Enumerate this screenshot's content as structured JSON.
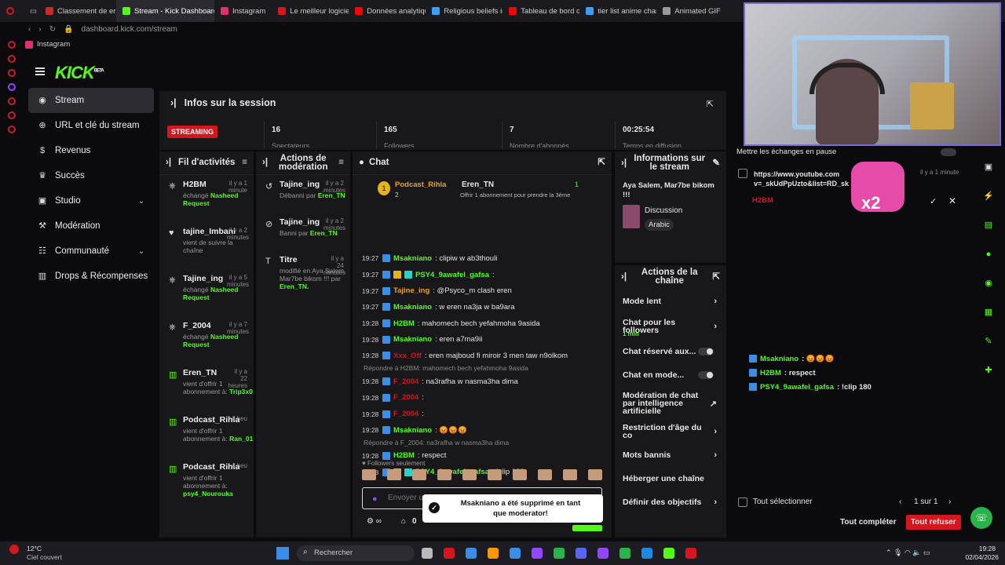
{
  "browser": {
    "tabs": [
      {
        "label": "Classement de ere",
        "color": "#cc2a2a"
      },
      {
        "label": "Stream - Kick Dashboard",
        "color": "#53fc18"
      },
      {
        "label": "Instagram",
        "color": "#e1306c"
      },
      {
        "label": "Le meilleur logicie",
        "color": "#d4171e"
      },
      {
        "label": "Données analytiqu",
        "color": "#ff0000"
      },
      {
        "label": "Religious beliefs in",
        "color": "#3aa0ff"
      },
      {
        "label": "Tableau de bord c",
        "color": "#ff0000"
      },
      {
        "label": "tier list anime char",
        "color": "#3aa0ff"
      },
      {
        "label": "Animated GIF",
        "color": "#9a9a9a"
      }
    ],
    "url": "dashboard.kick.com/stream",
    "bookmark": "Instagram"
  },
  "logo": "KICK",
  "logo_badge": "BETA",
  "nav": [
    {
      "label": "Stream",
      "icon": "broadcast-icon"
    },
    {
      "label": "URL et clé du stream",
      "icon": "link-icon"
    },
    {
      "label": "Revenus",
      "icon": "dollar-icon"
    },
    {
      "label": "Succès",
      "icon": "trophy-icon"
    },
    {
      "label": "Studio",
      "icon": "studio-icon",
      "chev": "⌄"
    },
    {
      "label": "Modération",
      "icon": "hammer-icon"
    },
    {
      "label": "Communauté",
      "icon": "community-icon",
      "chev": "⌄"
    },
    {
      "label": "Drops & Récompenses",
      "icon": "gift-icon"
    }
  ],
  "infos": {
    "title": "Infos sur la session",
    "badge": "STREAMING",
    "stats": [
      {
        "value": "16",
        "label": "Spectateurs"
      },
      {
        "value": "165",
        "label": "Followers"
      },
      {
        "value": "7",
        "label": "Nombre d'abonnés"
      },
      {
        "value": "00:25:54",
        "label": "Temps en diffusion"
      }
    ]
  },
  "activity": {
    "title": "Fil d'activités",
    "items": [
      {
        "name": "H2BM",
        "time": "il y a 1 minute",
        "line1": "échangé",
        "hl": "Nasheed Request",
        "icon": "steering-icon"
      },
      {
        "name": "tajine_Imbani",
        "time": "il y a 2 minutes",
        "line1": "vient de suivre la chaîne",
        "hl": "",
        "icon": "heart-icon"
      },
      {
        "name": "Tajine_ing",
        "time": "il y a 5 minutes",
        "line1": "échangé",
        "hl": "Nasheed Request",
        "icon": "steering-icon"
      },
      {
        "name": "F_2004",
        "time": "il y a 7 minutes",
        "line1": "échangé",
        "hl": "Nasheed Request",
        "icon": "steering-icon"
      },
      {
        "name": "Eren_TN",
        "time": "il y a 22 heures",
        "line1": "vient d'offrir 1 abonnement à:",
        "hl": "Trip3x0",
        "icon": "gift-icon"
      },
      {
        "name": "Podcast_Rihla",
        "time": "il heu",
        "line1": "vient d'offrir 1 abonnement à:",
        "hl": "Ran_01",
        "icon": "gift-icon"
      },
      {
        "name": "Podcast_Rihla",
        "time": "il heu",
        "line1": "vient d'offrir 1 abonnement à:",
        "hl": "psy4_Nourouka",
        "icon": "gift-icon"
      }
    ]
  },
  "modactions": {
    "title": "Actions de modération",
    "items": [
      {
        "name": "Tajine_ing",
        "time": "il y a 2 minutes",
        "line1": "Débanni par",
        "hl": "Eren_TN",
        "icon": "unban-icon"
      },
      {
        "name": "Tajine_ing",
        "time": "il y a 2 minutes",
        "line1": "Banni par",
        "hl": "Eren_TN",
        "icon": "ban-icon"
      },
      {
        "name": "Titre",
        "time": "il y a 24 minutes",
        "line1": "modifié en Aya Salem, Mar7be bikom !!! par",
        "hl": "Eren_TN.",
        "icon": "tag-icon"
      }
    ]
  },
  "chat": {
    "title": "Chat",
    "pinned_user": "Podcast_Rihla",
    "pinned_count": "2",
    "gifter": "Eren_TN",
    "gift_count": "1",
    "gift_text": "Offrir 1 abonnement pour prendre la 3ème",
    "messages": [
      {
        "time": "19:27",
        "user": "Msakniano",
        "color": "#53fc18",
        "text": ": clipiw w ab3thouli"
      },
      {
        "time": "19:27",
        "user": "PSY4_9awafel_gafsa",
        "color": "#53fc18",
        "text": ":"
      },
      {
        "time": "19:27",
        "user": "Tajine_ing",
        "color": "#e8a31f",
        "text": ": @Psyco_m clash eren"
      },
      {
        "time": "19:27",
        "user": "Msakniano",
        "color": "#53fc18",
        "text": ": w eren na3ja w ba9ara"
      },
      {
        "time": "19:28",
        "user": "H2BM",
        "color": "#53fc18",
        "text": ": mahomech bech yefahmoha 9asida"
      },
      {
        "time": "19:28",
        "user": "Msakniano",
        "color": "#53fc18",
        "text": ": eren a7ma9ii"
      },
      {
        "time": "19:28",
        "user": "Xxx_Off",
        "color": "#d4171e",
        "text": ": eren majboud fi miroir 3 men taw n9olkom"
      },
      {
        "reply": "Répondre à H2BM: mahomech bech yefahmoha 9asida"
      },
      {
        "time": "19:28",
        "user": "F_2004",
        "color": "#d4171e",
        "text": ": na3rafha w nasma3ha dima"
      },
      {
        "time": "19:28",
        "user": "F_2004",
        "color": "#d4171e",
        "text": ":"
      },
      {
        "time": "19:28",
        "user": "F_2004",
        "color": "#d4171e",
        "text": ":"
      },
      {
        "time": "19:28",
        "user": "Msakniano",
        "color": "#53fc18",
        "text": ": 😡😡😡"
      },
      {
        "reply": "Répondre à F_2004: na3rafha w nasma3ha dima"
      },
      {
        "time": "19:28",
        "user": "H2BM",
        "color": "#53fc18",
        "text": ": respect"
      },
      {
        "time": "19:28",
        "user": "PSY4_9awafel_gafsa",
        "color": "#53fc18",
        "text": ": !clip 180"
      }
    ],
    "followers_only": "Followers seulement",
    "input_placeholder": "Envoyer un",
    "footer_count": "0"
  },
  "toast": "Msakniano a été supprimé en tant que moderator!",
  "streaminfo": {
    "title": "Informations sur le stream",
    "stream_title": "Aya Salem, Mar7be bikom !!!",
    "category": "Discussion",
    "tag": "Arabic"
  },
  "channel": {
    "title": "Actions de la chaîne",
    "rows": [
      {
        "label": "Mode lent",
        "kind": "arrow",
        "glyph": "›"
      },
      {
        "label": "Chat pour les followers",
        "sub": "1 min",
        "kind": "arrow",
        "glyph": "›"
      },
      {
        "label": "Chat réservé aux...",
        "kind": "toggle"
      },
      {
        "label": "Chat en mode...",
        "kind": "toggle"
      },
      {
        "label": "Modération de chat par intelligence artificielle",
        "kind": "link",
        "glyph": "↗"
      },
      {
        "label": "Restriction d'âge du co",
        "kind": "arrow",
        "glyph": "›"
      },
      {
        "label": "Mots bannis",
        "kind": "arrow",
        "glyph": "›"
      },
      {
        "label": "Héberger une chaîne",
        "kind": "none"
      },
      {
        "label": "Définir des objectifs",
        "kind": "arrow",
        "glyph": "›"
      }
    ]
  },
  "queue": {
    "pause_label": "Mettre les échanges en pause",
    "request_url": "https://www.youtube.com v=_skUdPpUzto&list=RD_sk",
    "request_time": "il y a 1 minute",
    "request_user": "H2BM",
    "overlay_text": "x2",
    "select_all": "Tout sélectionner",
    "pagination": "1 sur 1",
    "complete_all": "Tout compléter",
    "refuse_all": "Tout refuser"
  },
  "overlay_chat": [
    {
      "user": "Msakniano",
      "text": ": 😡😡😡"
    },
    {
      "user": "H2BM",
      "text": ": respect"
    },
    {
      "user": "PSY4_9awafel_gafsa",
      "text": ": !clip 180"
    }
  ],
  "taskbar": {
    "temp": "12°C",
    "weather": "Ciel couvert",
    "search": "Rechercher",
    "time": "19:28",
    "date": "02/04/2026"
  }
}
